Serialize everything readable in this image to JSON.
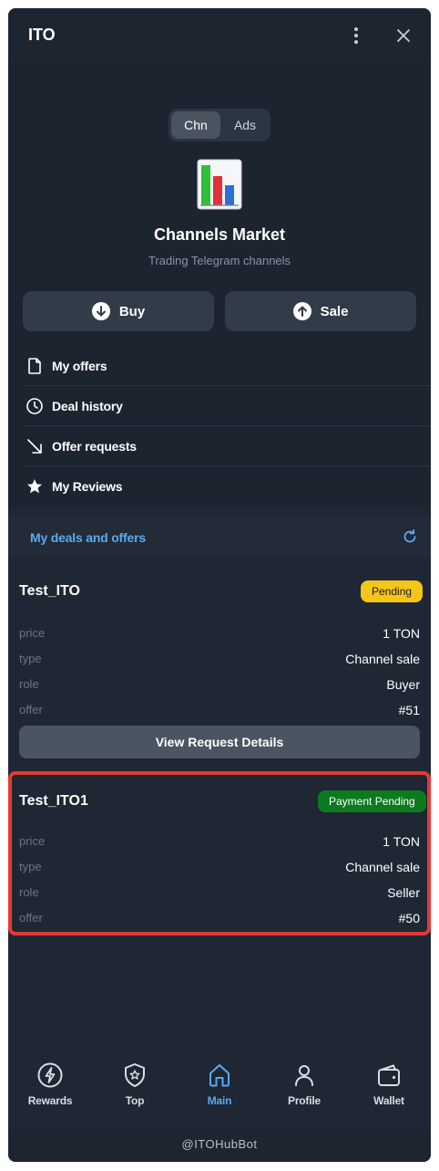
{
  "window": {
    "title": "ITO"
  },
  "segment": {
    "active": "Chn",
    "inactive": "Ads"
  },
  "hero": {
    "title": "Channels Market",
    "subtitle": "Trading Telegram channels",
    "buy_label": "Buy",
    "sale_label": "Sale"
  },
  "menu": {
    "items": [
      {
        "label": "My offers",
        "icon": "document-icon"
      },
      {
        "label": "Deal history",
        "icon": "clock-icon"
      },
      {
        "label": "Offer requests",
        "icon": "arrow-down-right-icon"
      },
      {
        "label": "My Reviews",
        "icon": "star-icon"
      }
    ]
  },
  "deals": {
    "header": "My deals and offers",
    "cards": [
      {
        "name": "Test_ITO",
        "status": "Pending",
        "rows": [
          {
            "key": "price",
            "value": "1 TON"
          },
          {
            "key": "type",
            "value": "Channel sale"
          },
          {
            "key": "role",
            "value": "Buyer"
          },
          {
            "key": "offer",
            "value": "#51"
          }
        ],
        "action": "View Request Details"
      },
      {
        "name": "Test_ITO1",
        "status": "Payment Pending",
        "rows": [
          {
            "key": "price",
            "value": "1 TON"
          },
          {
            "key": "type",
            "value": "Channel sale"
          },
          {
            "key": "role",
            "value": "Seller"
          },
          {
            "key": "offer",
            "value": "#50"
          }
        ]
      }
    ]
  },
  "nav": {
    "items": [
      {
        "label": "Rewards",
        "icon": "lightning-icon"
      },
      {
        "label": "Top",
        "icon": "badge-star-icon"
      },
      {
        "label": "Main",
        "icon": "home-icon",
        "active": true
      },
      {
        "label": "Profile",
        "icon": "person-icon"
      },
      {
        "label": "Wallet",
        "icon": "wallet-icon"
      }
    ]
  },
  "footer": {
    "bot": "@ITOHubBot"
  },
  "colors": {
    "background": "#1e2733",
    "accent": "#5aa9f0",
    "pending": "#f5c518",
    "payment_pending": "#0d7a1f",
    "highlight": "#e53935"
  }
}
